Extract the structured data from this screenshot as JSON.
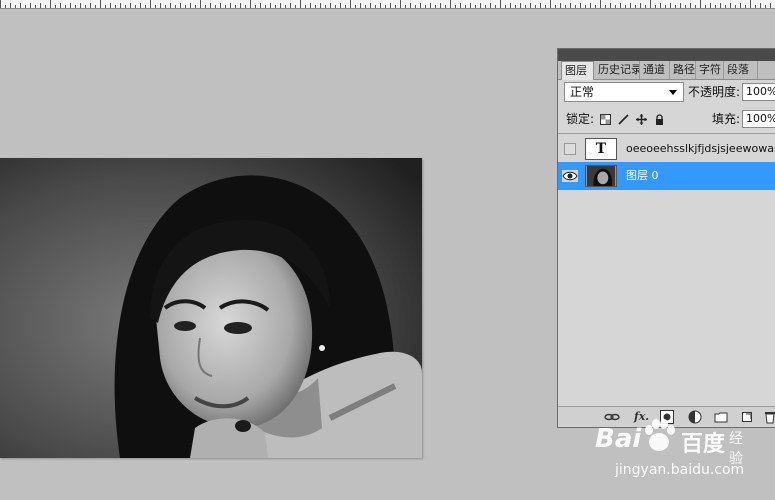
{
  "panel": {
    "tabs": [
      {
        "label": "图层",
        "active": true
      },
      {
        "label": "历史记录",
        "active": false
      },
      {
        "label": "通道",
        "active": false
      },
      {
        "label": "路径",
        "active": false
      },
      {
        "label": "字符",
        "active": false
      },
      {
        "label": "段落",
        "active": false
      }
    ],
    "blend_mode": "正常",
    "opacity_label": "不透明度:",
    "opacity_value": "100%",
    "lock_label": "锁定:",
    "fill_label": "填充:",
    "fill_value": "100%",
    "layers": [
      {
        "name": "oeeoeehsslkjfjdsjsjeewowan…",
        "type": "text",
        "thumb_label": "T",
        "visible": false,
        "selected": false
      },
      {
        "name": "图层 0",
        "type": "image",
        "visible": true,
        "selected": true
      }
    ],
    "bottom_icons": [
      "link-icon",
      "fx-icon",
      "mask-icon",
      "adjustment-icon",
      "folder-icon",
      "new-layer-icon",
      "trash-icon"
    ],
    "fx_label": "fx."
  },
  "watermark": {
    "brand_left": "Bai",
    "brand_right": "百度",
    "sub": "经验",
    "url": "jingyan.baidu.com"
  },
  "colors": {
    "selection": "#3399ff",
    "workspace": "#c0c0c0",
    "panel_bg": "#d6d6d6"
  }
}
